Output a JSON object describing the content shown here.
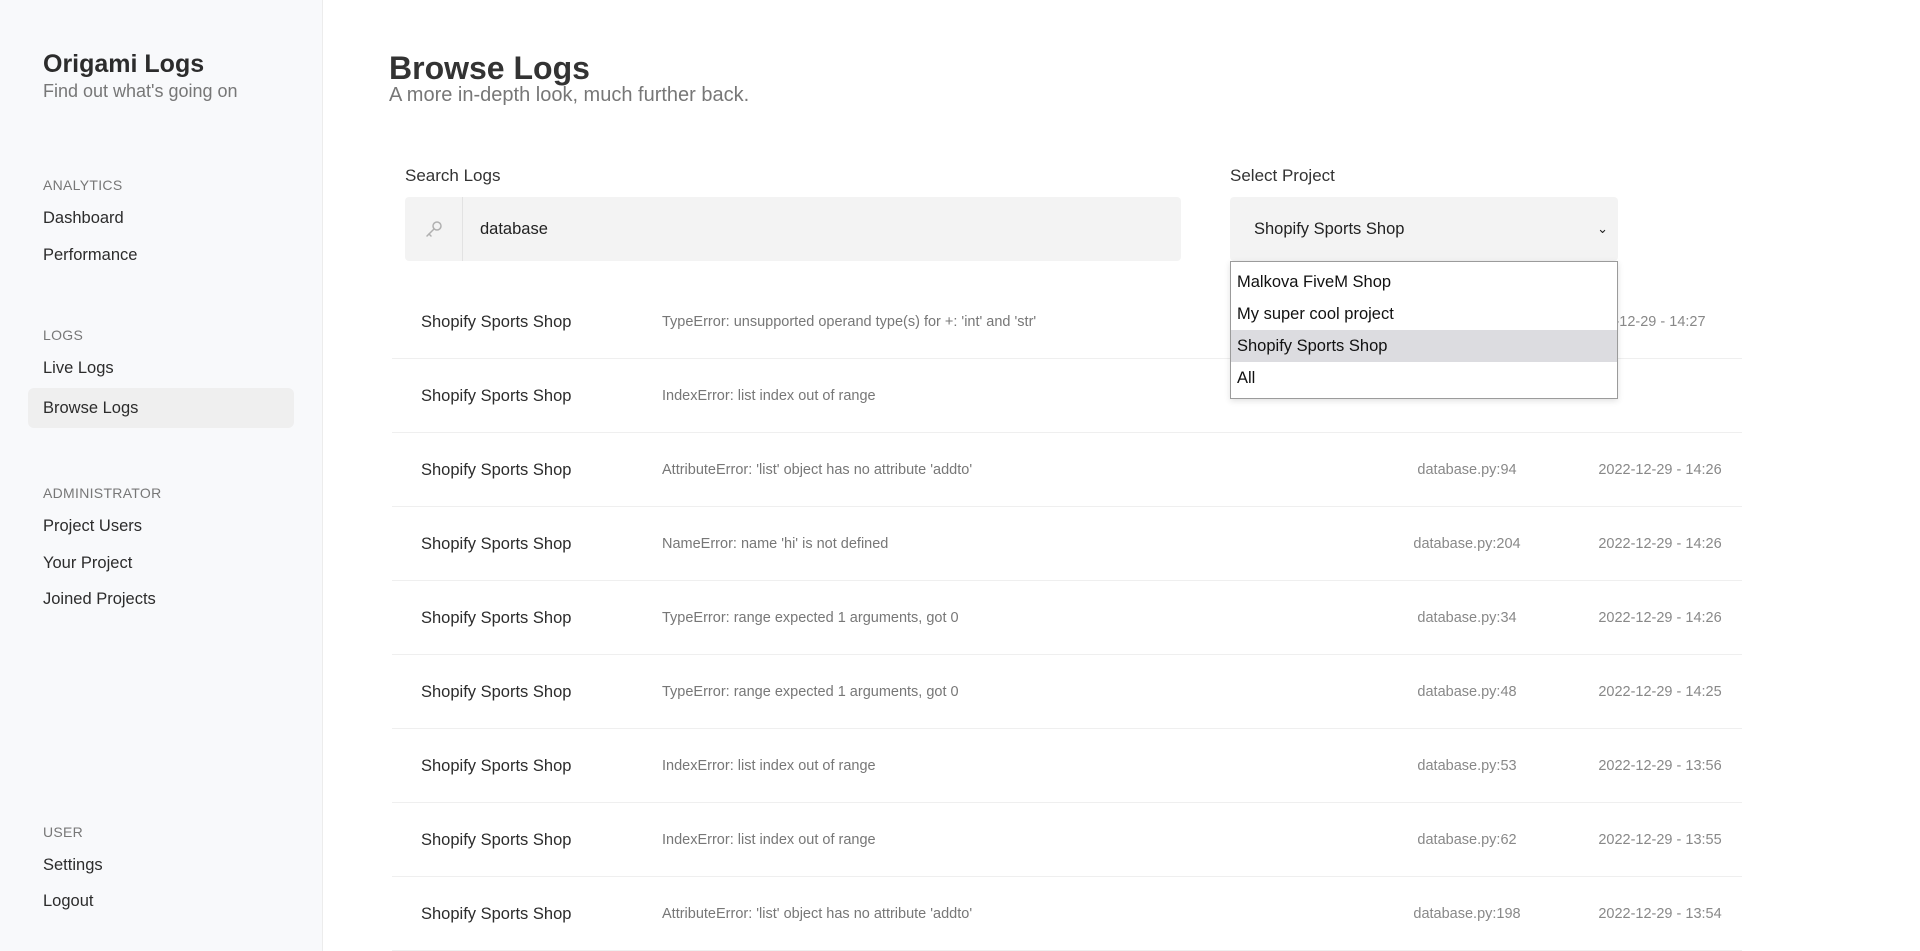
{
  "sidebar": {
    "title": "Origami Logs",
    "subtitle": "Find out what's going on",
    "sections": [
      {
        "label": "ANALYTICS",
        "items": [
          "Dashboard",
          "Performance"
        ]
      },
      {
        "label": "LOGS",
        "items": [
          "Live Logs",
          "Browse Logs"
        ]
      },
      {
        "label": "ADMINISTRATOR",
        "items": [
          "Project Users",
          "Your Project",
          "Joined Projects"
        ]
      },
      {
        "label": "USER",
        "items": [
          "Settings",
          "Logout"
        ]
      }
    ],
    "active_item": "Browse Logs"
  },
  "header": {
    "title": "Browse Logs",
    "subtitle": "A more in-depth look, much further back."
  },
  "search": {
    "label": "Search Logs",
    "value": "database",
    "icon": "key-icon"
  },
  "project_select": {
    "label": "Select Project",
    "selected": "Shopify Sports Shop",
    "options": [
      "Malkova FiveM Shop",
      "My super cool project",
      "Shopify Sports Shop",
      "All"
    ]
  },
  "logs": [
    {
      "project": "Shopify Sports Shop",
      "message": "TypeError: unsupported operand type(s) for +: 'int' and 'str'",
      "file": "",
      "time": "-12-29 - 14:27"
    },
    {
      "project": "Shopify Sports Shop",
      "message": "IndexError: list index out of range",
      "file": "",
      "time": ""
    },
    {
      "project": "Shopify Sports Shop",
      "message": "AttributeError: 'list' object has no attribute 'addto'",
      "file": "database.py:94",
      "time": "2022-12-29 - 14:26"
    },
    {
      "project": "Shopify Sports Shop",
      "message": "NameError: name 'hi' is not defined",
      "file": "database.py:204",
      "time": "2022-12-29 - 14:26"
    },
    {
      "project": "Shopify Sports Shop",
      "message": "TypeError: range expected 1 arguments, got 0",
      "file": "database.py:34",
      "time": "2022-12-29 - 14:26"
    },
    {
      "project": "Shopify Sports Shop",
      "message": "TypeError: range expected 1 arguments, got 0",
      "file": "database.py:48",
      "time": "2022-12-29 - 14:25"
    },
    {
      "project": "Shopify Sports Shop",
      "message": "IndexError: list index out of range",
      "file": "database.py:53",
      "time": "2022-12-29 - 13:56"
    },
    {
      "project": "Shopify Sports Shop",
      "message": "IndexError: list index out of range",
      "file": "database.py:62",
      "time": "2022-12-29 - 13:55"
    },
    {
      "project": "Shopify Sports Shop",
      "message": "AttributeError: 'list' object has no attribute 'addto'",
      "file": "database.py:198",
      "time": "2022-12-29 - 13:54"
    }
  ],
  "colors": {
    "sidebar_bg": "#f8f9fb",
    "active_item_bg": "#efefef",
    "input_bg": "#f3f3f3",
    "dropdown_selected_bg": "#dcdce0"
  }
}
